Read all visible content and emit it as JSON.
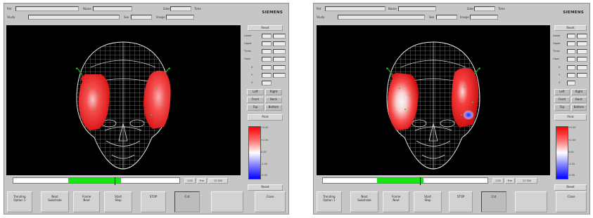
{
  "brand": "SIEMENS",
  "header": {
    "row1": [
      "Pat",
      "Name",
      "Date",
      "Time"
    ],
    "row2": [
      "Study",
      "Sex",
      "Image"
    ]
  },
  "controls": {
    "top_button": "Reset",
    "labels": [
      "Lower",
      "Upper",
      "Thres",
      "Opac.",
      "X",
      "Y",
      "Z"
    ],
    "row_buttons": [
      [
        "Left",
        "Right"
      ],
      [
        "Front",
        "Back"
      ],
      [
        "Top",
        "Bottom"
      ]
    ],
    "mid_button": "Print",
    "colorbar_ticks": [
      "+5.00",
      "+2.50",
      "0.00",
      "-2.50",
      "-5.00"
    ],
    "bottom_button": "Reset"
  },
  "slider": {
    "readouts": [
      "1.00",
      "Frm",
      "12.500"
    ]
  },
  "bottom_bar": {
    "buttons": [
      "Trending\nOption 1",
      "Next\nSubstrate",
      "Frame\nNext",
      "Start\nStop",
      "STOP",
      "Cnt",
      "",
      "Close"
    ]
  },
  "panels": [
    {
      "name": "left",
      "slider_fill_start": 0.33,
      "slider_fill_end": 0.65,
      "slider_thumb": 0.61
    },
    {
      "name": "right",
      "slider_fill_start": 0.33,
      "slider_fill_end": 0.61,
      "slider_thumb": 0.59
    }
  ],
  "colors": {
    "activation": "#ff2a2a",
    "deactivation": "#2a2aff",
    "progress": "#16e616",
    "panel": "#c6c6c6"
  }
}
